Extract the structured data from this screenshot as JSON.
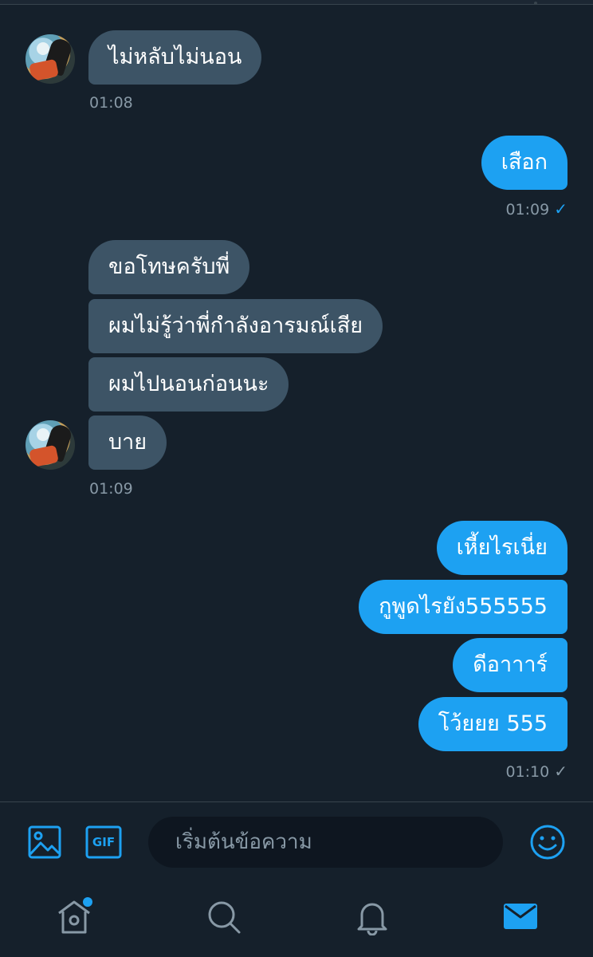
{
  "conversation": {
    "group1": {
      "messages": [
        "ไม่หลับไม่นอน"
      ],
      "time": "01:08"
    },
    "group2": {
      "messages": [
        "เสือก"
      ],
      "time": "01:09",
      "status_icon": "check-blue"
    },
    "group3": {
      "messages": [
        "ขอโทษครับพี่",
        "ผมไม่รู้ว่าพี่กำลังอารมณ์เสีย",
        "ผมไปนอนก่อนนะ",
        "บาย"
      ],
      "time": "01:09"
    },
    "group4": {
      "messages": [
        "เหี้ยไรเนี่ย",
        "กูพูดไรยัง555555",
        "ดีอาาาร์",
        "โว้ยยย 555"
      ],
      "time": "01:10",
      "status_icon": "check-grey"
    }
  },
  "composer": {
    "placeholder": "เริ่มต้นข้อความ",
    "gif_label": "GIF",
    "icons": [
      "image-icon",
      "gif-icon",
      "emoji-icon"
    ]
  },
  "tabs": [
    {
      "name": "home",
      "icon": "home-icon",
      "has_notification": true
    },
    {
      "name": "search",
      "icon": "search-icon"
    },
    {
      "name": "notifications",
      "icon": "bell-icon"
    },
    {
      "name": "messages",
      "icon": "mail-icon",
      "active": true
    }
  ],
  "colors": {
    "background": "#15202b",
    "incoming_bubble": "#3d5466",
    "outgoing_bubble": "#1da1f2",
    "accent": "#1da1f2",
    "muted_text": "#8899a6"
  }
}
